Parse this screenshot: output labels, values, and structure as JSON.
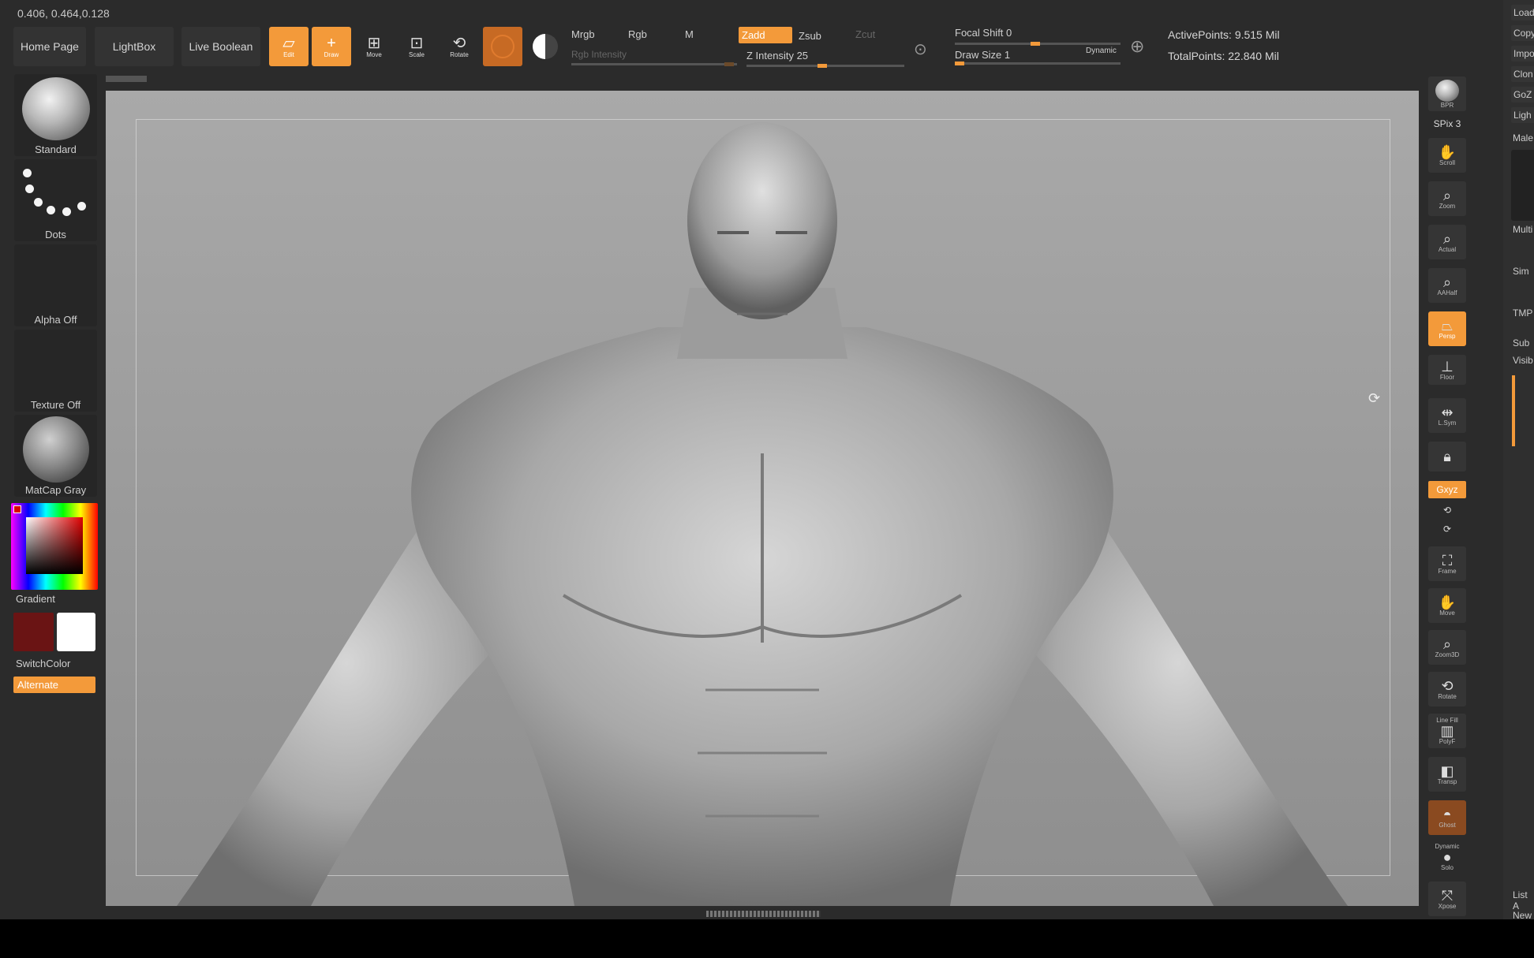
{
  "coords": "0.406, 0.464,0.128",
  "top_buttons": {
    "home": "Home Page",
    "lightbox": "LightBox",
    "live_boolean": "Live Boolean"
  },
  "tools": {
    "edit": "Edit",
    "draw": "Draw",
    "move": "Move",
    "scale": "Scale",
    "rotate": "Rotate"
  },
  "color_modes": {
    "mrgb": "Mrgb",
    "rgb": "Rgb",
    "m": "M",
    "rgb_intensity": "Rgb Intensity"
  },
  "sculpt_modes": {
    "zadd": "Zadd",
    "zsub": "Zsub",
    "zcut": "Zcut",
    "z_intensity": "Z Intensity 25"
  },
  "draw_params": {
    "focal_shift": "Focal Shift 0",
    "draw_size": "Draw Size 1",
    "dynamic": "Dynamic"
  },
  "stats": {
    "active_points": "ActivePoints: 9.515 Mil",
    "total_points": "TotalPoints: 22.840 Mil"
  },
  "left_shelf": {
    "brush": "Standard",
    "stroke": "Dots",
    "alpha": "Alpha Off",
    "texture": "Texture Off",
    "material": "MatCap Gray",
    "gradient": "Gradient",
    "switch_color": "SwitchColor",
    "alternate": "Alternate",
    "primary_color": "#6a1414",
    "secondary_color": "#ffffff"
  },
  "right_tools": {
    "bpr": "BPR",
    "spix": "SPix 3",
    "scroll": "Scroll",
    "zoom": "Zoom",
    "actual": "Actual",
    "aahalf": "AAHalf",
    "persp": "Persp",
    "floor": "Floor",
    "lsym": "L.Sym",
    "xyz": "Gxyz",
    "frame": "Frame",
    "move": "Move",
    "zoom3d": "Zoom3D",
    "rotate": "Rotate",
    "linefill": "Line Fill",
    "polyf": "PolyF",
    "transp": "Transp",
    "ghost": "Ghost",
    "dynamic": "Dynamic",
    "solo": "Solo",
    "xpose": "Xpose"
  },
  "right_menu": [
    "Load",
    "Copy",
    "Impo",
    "Clon",
    "GoZ",
    "Ligh",
    "Male"
  ],
  "right_extra": {
    "multi": "Multi",
    "sim": "Sim",
    "tmp": "TMP",
    "sub": "Sub",
    "visib": "Visib",
    "list": "List A",
    "new": "New"
  },
  "accent": "#f39a3a"
}
